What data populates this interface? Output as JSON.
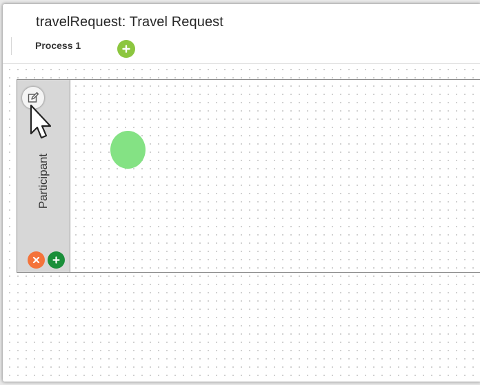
{
  "header": {
    "title": "travelRequest: Travel Request",
    "process_tab": "Process 1"
  },
  "lane": {
    "label": "Participant"
  },
  "icons": {
    "add_process": "plus-icon",
    "edit_lane": "edit-icon",
    "delete_lane": "close-icon",
    "add_lane": "plus-icon"
  },
  "colors": {
    "add_process": "#8cc63f",
    "delete": "#f4733a",
    "add_lane": "#1a8f3a",
    "start_event": "#84e284"
  }
}
